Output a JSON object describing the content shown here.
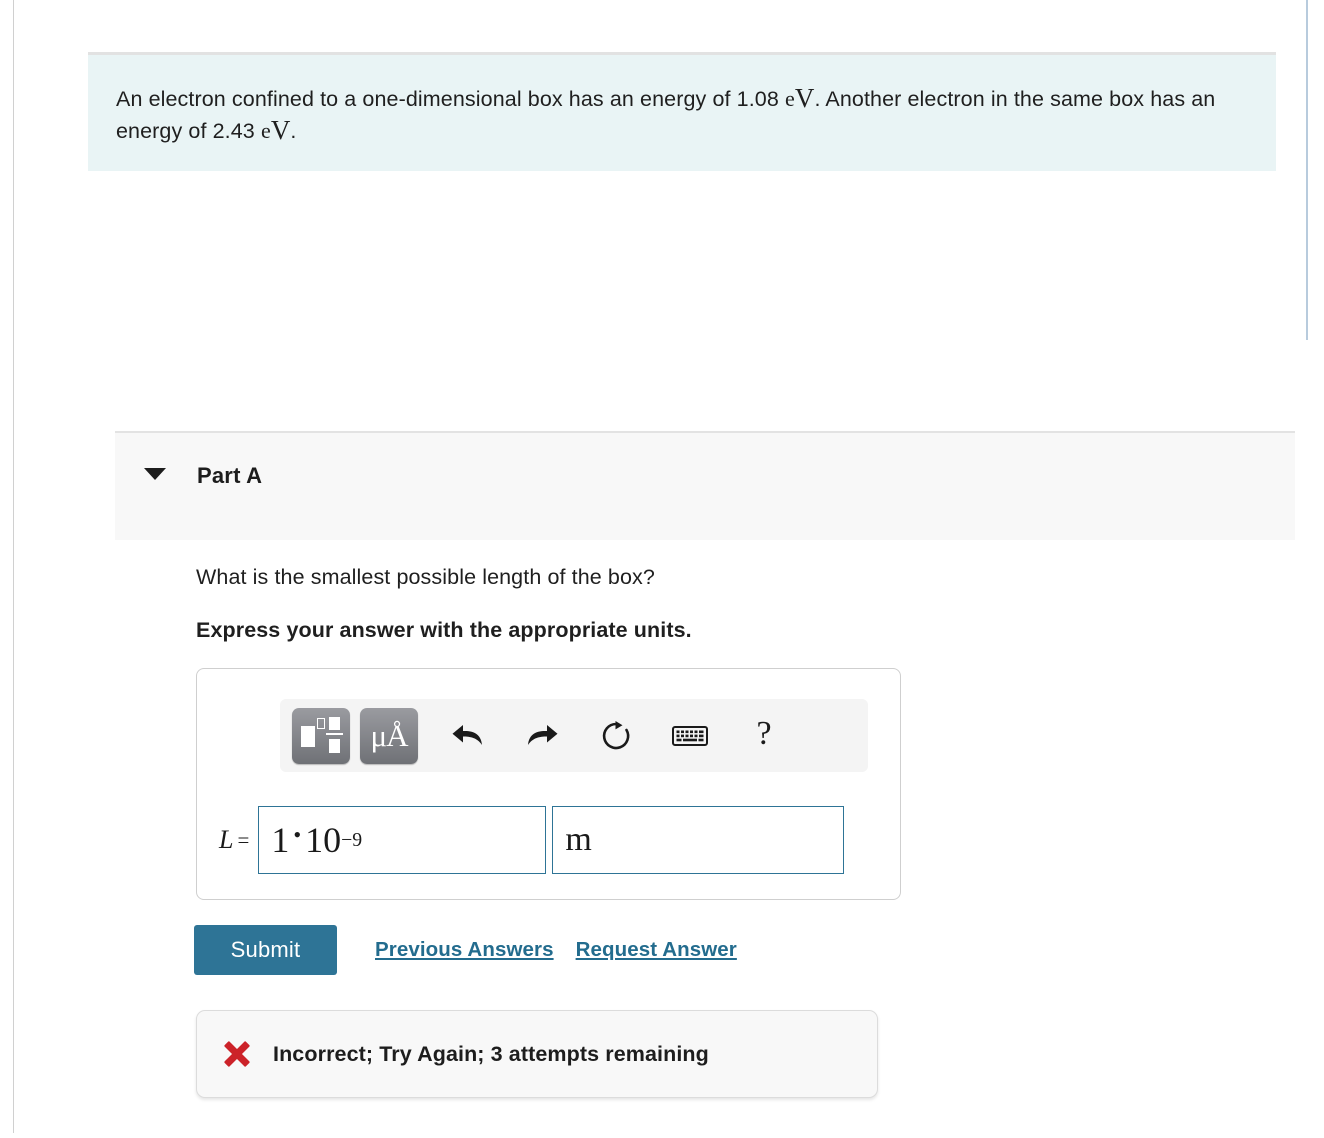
{
  "problem": {
    "text_before_unit1": "An electron confined to a one-dimensional box has an energy of 1.08 ",
    "unit1": "eV",
    "text_between": ". Another electron in the same box has an energy of 2.43 ",
    "unit2": "eV",
    "text_after": ".",
    "background_color": "#e9f4f5"
  },
  "part": {
    "title": "Part A",
    "caret_icon": "chevron-down-icon",
    "background_color": "#f8f8f8"
  },
  "question": {
    "prompt": "What is the smallest possible length of the box?",
    "instruction": "Express your answer with the appropriate units."
  },
  "toolbar": {
    "buttons": [
      {
        "name": "math-template-button",
        "icon": "math-template-icon",
        "label": ""
      },
      {
        "name": "units-button",
        "icon": "micro-angstrom-icon",
        "label": "μÅ"
      },
      {
        "name": "undo-button",
        "icon": "undo-arrow-icon",
        "label": ""
      },
      {
        "name": "redo-button",
        "icon": "redo-arrow-icon",
        "label": ""
      },
      {
        "name": "reset-button",
        "icon": "reset-circular-arrow-icon",
        "label": ""
      },
      {
        "name": "keyboard-button",
        "icon": "keyboard-icon",
        "label": ""
      },
      {
        "name": "help-button",
        "icon": "question-mark-icon",
        "label": "?"
      }
    ]
  },
  "answer": {
    "variable": "L",
    "equals": "=",
    "value_mantissa": "1",
    "value_operator": "•",
    "value_base": "10",
    "value_exponent": "−9",
    "unit_value": "m",
    "field_border_color": "#2e7496"
  },
  "actions": {
    "submit_label": "Submit",
    "previous_answers_label": "Previous Answers",
    "request_answer_label": "Request Answer",
    "submit_color": "#2e7496",
    "link_color": "#236c8e"
  },
  "feedback": {
    "icon": "red-x-icon",
    "icon_color": "#cc2229",
    "message": "Incorrect; Try Again; 3 attempts remaining"
  }
}
